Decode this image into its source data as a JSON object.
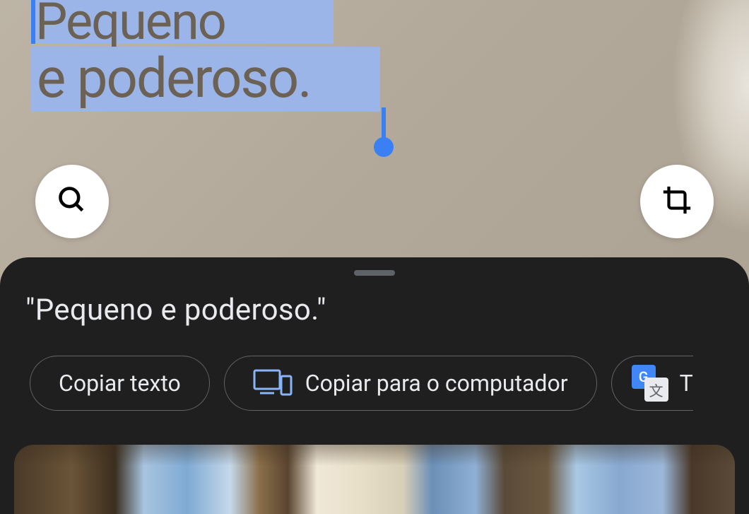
{
  "ocr": {
    "line1": "Pequeno",
    "line2": "e poderoso."
  },
  "sheet": {
    "selected_text": "\"Pequeno e poderoso.\""
  },
  "actions": {
    "copy_text": "Copiar texto",
    "copy_to_computer": "Copiar para o computador",
    "translate_partial": "T"
  },
  "colors": {
    "selection": "#9cb5e8",
    "handle": "#3b7ff5",
    "sheet_bg": "#1f1f1f"
  }
}
